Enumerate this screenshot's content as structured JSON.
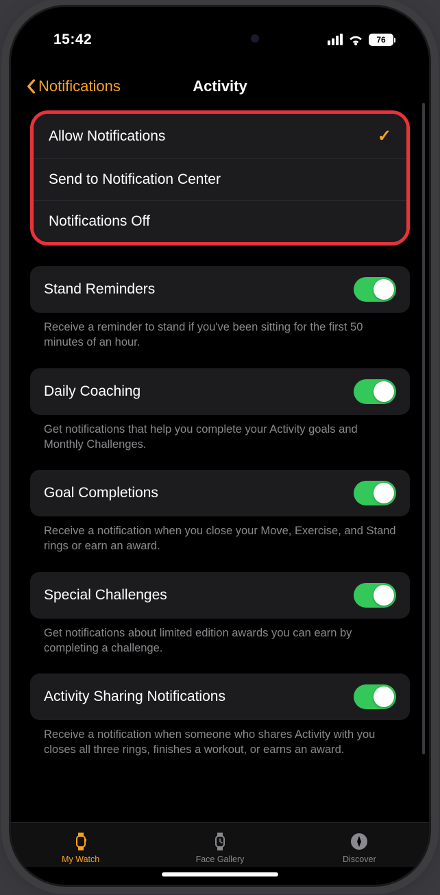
{
  "status": {
    "time": "15:42",
    "battery": "76"
  },
  "header": {
    "back_label": "Notifications",
    "title": "Activity"
  },
  "notification_options": {
    "allow": "Allow Notifications",
    "send_center": "Send to Notification Center",
    "off": "Notifications Off",
    "selected": "allow"
  },
  "settings": {
    "stand": {
      "label": "Stand Reminders",
      "desc": "Receive a reminder to stand if you've been sitting for the first 50 minutes of an hour."
    },
    "coaching": {
      "label": "Daily Coaching",
      "desc": "Get notifications that help you complete your Activity goals and Monthly Challenges."
    },
    "goal": {
      "label": "Goal Completions",
      "desc": "Receive a notification when you close your Move, Exercise, and Stand rings or earn an award."
    },
    "special": {
      "label": "Special Challenges",
      "desc": "Get notifications about limited edition awards you can earn by completing a challenge."
    },
    "sharing": {
      "label": "Activity Sharing Notifications",
      "desc": "Receive a notification when someone who shares Activity with you closes all three rings, finishes a workout, or earns an award."
    }
  },
  "tabs": {
    "my_watch": "My Watch",
    "face_gallery": "Face Gallery",
    "discover": "Discover"
  }
}
